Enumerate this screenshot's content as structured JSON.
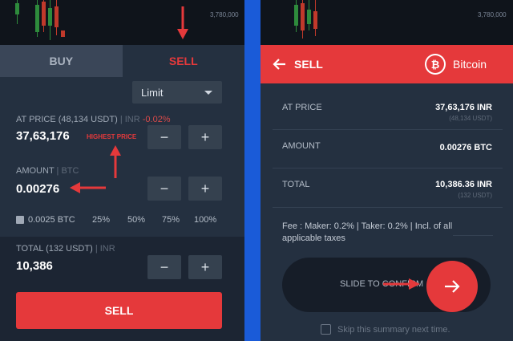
{
  "left": {
    "chart_price_tag": "3,780,000",
    "tabs": {
      "buy": "BUY",
      "sell": "SELL"
    },
    "order_type": "Limit",
    "at_price": {
      "label_main": "AT PRICE (48,134 USDT)",
      "label_unit": "| INR",
      "label_change": "-0.02%",
      "value": "37,63,176",
      "hint": "HIGHEST PRICE"
    },
    "amount": {
      "label_main": "AMOUNT",
      "label_unit": "| BTC",
      "value": "0.00276"
    },
    "balance": "0.0025 BTC",
    "percent_options": [
      "25%",
      "50%",
      "75%",
      "100%"
    ],
    "total": {
      "label_main": "TOTAL (132 USDT)",
      "label_unit": "| INR",
      "value": "10,386"
    },
    "minus": "−",
    "plus": "+",
    "sell_button": "SELL"
  },
  "right": {
    "chart_price_tag": "3,780,000",
    "header": {
      "title": "SELL",
      "coin_symbol": "₿",
      "coin_name": "Bitcoin"
    },
    "summary": [
      {
        "label": "AT PRICE",
        "value": "37,63,176 INR",
        "sub": "(48,134 USDT)"
      },
      {
        "label": "AMOUNT",
        "value": "0.00276 BTC",
        "sub": ""
      },
      {
        "label": "TOTAL",
        "value": "10,386.36 INR",
        "sub": "(132 USDT)"
      }
    ],
    "fee_text": "Fee : Maker: 0.2% | Taker: 0.2% | Incl. of all applicable taxes",
    "slider_text": "SLIDE TO CONFIRM",
    "skip_text": "Skip this summary next time."
  },
  "colors": {
    "accent_red": "#e5393b",
    "background": "#243040",
    "divider_blue": "#1a5bd8"
  }
}
